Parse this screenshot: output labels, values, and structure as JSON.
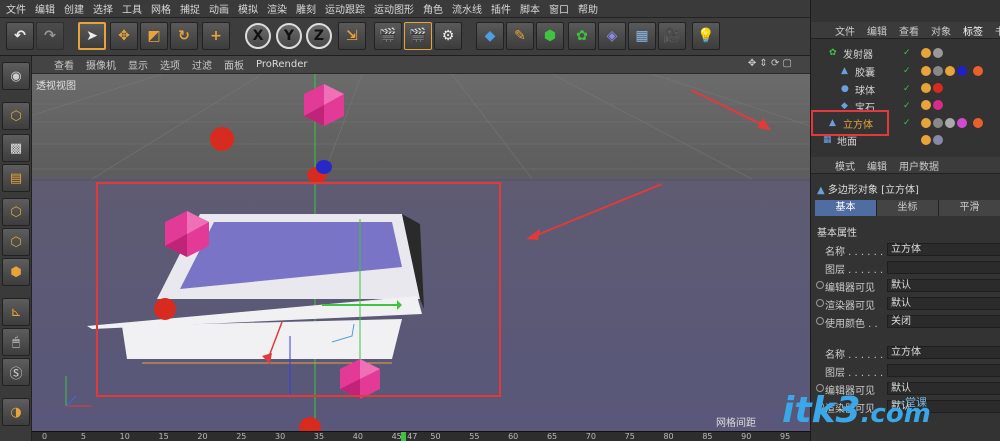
{
  "menu": [
    "文件",
    "编辑",
    "创建",
    "选择",
    "工具",
    "网格",
    "捕捉",
    "动画",
    "模拟",
    "渲染",
    "雕刻",
    "运动跟踪",
    "运动图形",
    "角色",
    "流水线",
    "插件",
    "脚本",
    "窗口",
    "帮助"
  ],
  "toolbar": {
    "axis_x": "X",
    "axis_y": "Y",
    "axis_z": "Z"
  },
  "viewport": {
    "menu": [
      "查看",
      "摄像机",
      "显示",
      "选项",
      "过滤",
      "面板",
      "ProRender"
    ],
    "label": "透视视图",
    "grid_label": "网格间距"
  },
  "timeline": {
    "ticks": [
      "0",
      "5",
      "10",
      "15",
      "20",
      "25",
      "30",
      "35",
      "40",
      "45",
      "47",
      "50",
      "55",
      "60",
      "65",
      "70",
      "75",
      "80",
      "85",
      "90",
      "95"
    ],
    "current": "47"
  },
  "objects_panel": {
    "menu": [
      "文件",
      "编辑",
      "查看",
      "对象",
      "标签",
      "书"
    ],
    "items": [
      {
        "name": "发射器"
      },
      {
        "name": "胶囊"
      },
      {
        "name": "球体"
      },
      {
        "name": "宝石"
      },
      {
        "name": "立方体"
      },
      {
        "name": "地面"
      }
    ]
  },
  "attributes_panel": {
    "menu": [
      "模式",
      "编辑",
      "用户数据"
    ],
    "title": "多边形对象 [立方体]",
    "tabs": [
      "基本",
      "坐标",
      "平滑"
    ],
    "section": "基本属性",
    "rows": [
      {
        "label": "名称 . . . . . .",
        "value": "立方体"
      },
      {
        "label": "图层 . . . . . .",
        "value": ""
      },
      {
        "label": "编辑器可见",
        "value": "默认"
      },
      {
        "label": "渲染器可见",
        "value": "默认"
      },
      {
        "label": "使用颜色 . .",
        "value": "关闭"
      }
    ],
    "rows2": [
      {
        "label": "名称 . . . . . .",
        "value": "立方体"
      },
      {
        "label": "图层 . . . . . .",
        "value": ""
      },
      {
        "label": "编辑器可见",
        "value": "默认"
      },
      {
        "label": "渲染器可见",
        "value": "默认"
      }
    ]
  },
  "colors": {
    "accent": "#e8a43a",
    "highlight_box": "#e23a3a",
    "tab_active": "#4f6da0"
  },
  "watermark": {
    "text": "itk3",
    "domain": ".com",
    "sub": "一堂课"
  }
}
